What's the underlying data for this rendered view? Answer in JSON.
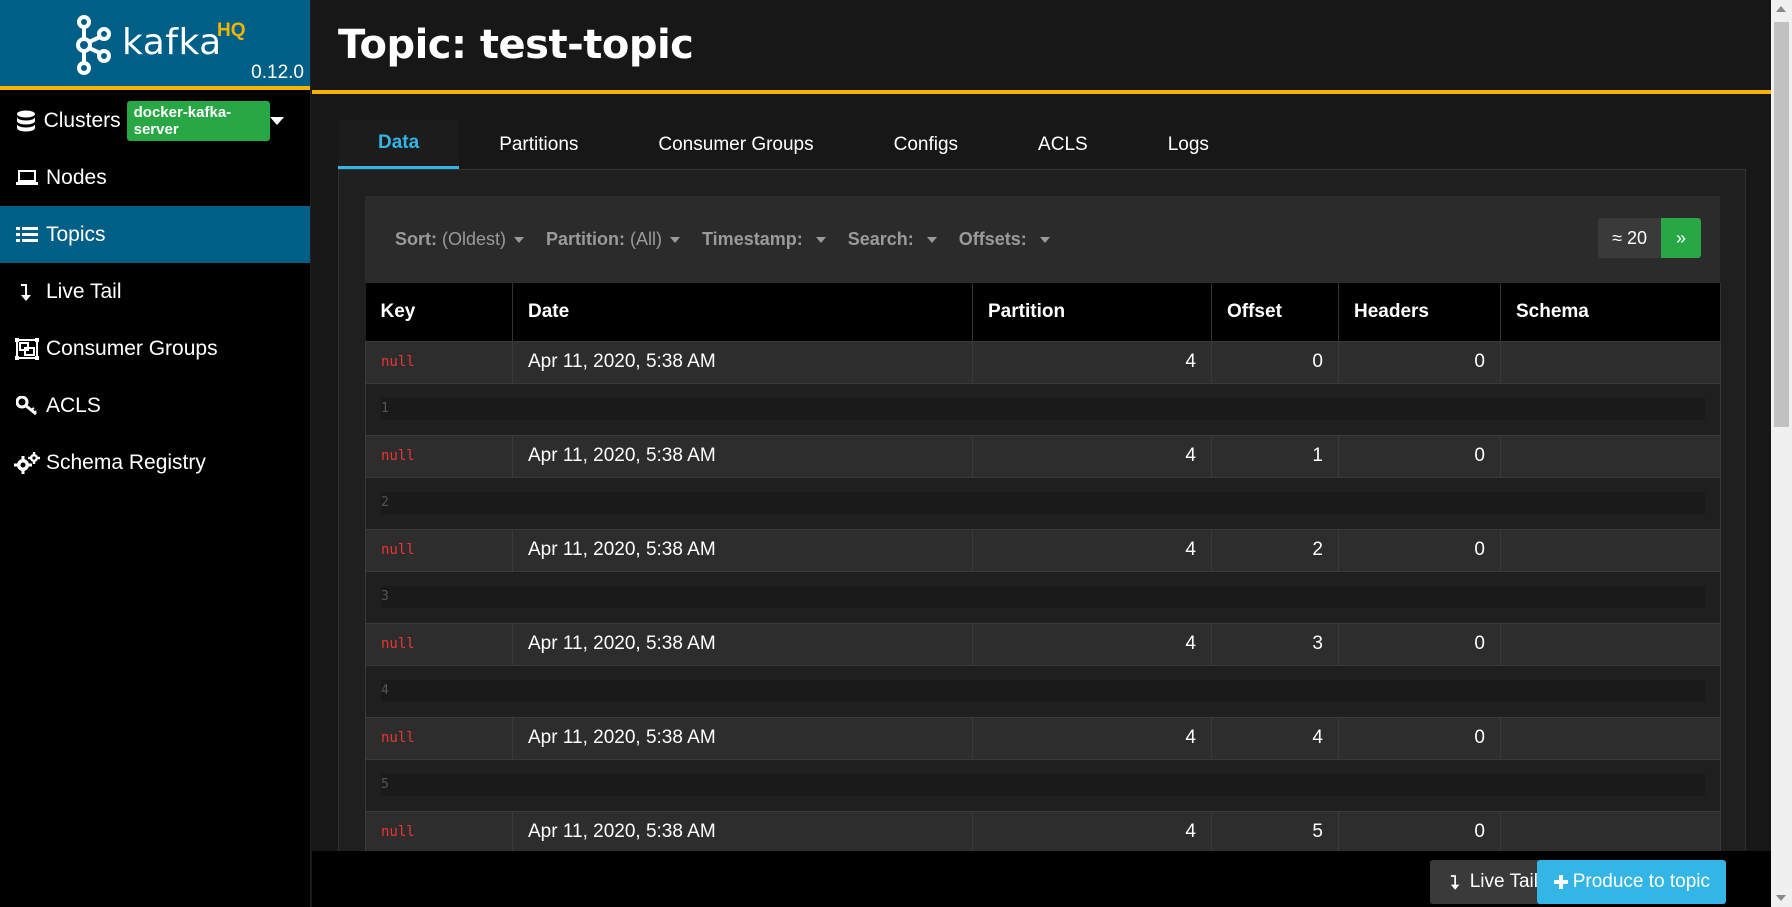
{
  "app": {
    "logo_text": "kafka",
    "logo_suffix": "HQ",
    "version": "0.12.0"
  },
  "sidebar": {
    "items": [
      {
        "label": "Clusters",
        "badge": "docker-kafka-server",
        "icon": "database-icon"
      },
      {
        "label": "Nodes",
        "icon": "laptop-icon"
      },
      {
        "label": "Topics",
        "icon": "list-icon",
        "active": true
      },
      {
        "label": "Live Tail",
        "icon": "level-down-icon"
      },
      {
        "label": "Consumer Groups",
        "icon": "object-group-icon"
      },
      {
        "label": "ACLS",
        "icon": "key-icon"
      },
      {
        "label": "Schema Registry",
        "icon": "cogs-icon"
      }
    ]
  },
  "header": {
    "title": "Topic: test-topic"
  },
  "tabs": [
    {
      "label": "Data",
      "active": true
    },
    {
      "label": "Partitions"
    },
    {
      "label": "Consumer Groups"
    },
    {
      "label": "Configs"
    },
    {
      "label": "ACLS"
    },
    {
      "label": "Logs"
    }
  ],
  "toolbar": {
    "sort_label": "Sort:",
    "sort_value": "(Oldest)",
    "partition_label": "Partition:",
    "partition_value": "(All)",
    "timestamp_label": "Timestamp:",
    "search_label": "Search:",
    "offsets_label": "Offsets:",
    "count": "≈ 20",
    "next": "»"
  },
  "table": {
    "columns": [
      "Key",
      "Date",
      "Partition",
      "Offset",
      "Headers",
      "Schema"
    ],
    "rows": [
      {
        "key": "null",
        "date": "Apr 11, 2020, 5:38 AM",
        "partition": "4",
        "offset": "0",
        "headers": "0",
        "schema": "",
        "value": "1"
      },
      {
        "key": "null",
        "date": "Apr 11, 2020, 5:38 AM",
        "partition": "4",
        "offset": "1",
        "headers": "0",
        "schema": "",
        "value": "2"
      },
      {
        "key": "null",
        "date": "Apr 11, 2020, 5:38 AM",
        "partition": "4",
        "offset": "2",
        "headers": "0",
        "schema": "",
        "value": "3"
      },
      {
        "key": "null",
        "date": "Apr 11, 2020, 5:38 AM",
        "partition": "4",
        "offset": "3",
        "headers": "0",
        "schema": "",
        "value": "4"
      },
      {
        "key": "null",
        "date": "Apr 11, 2020, 5:38 AM",
        "partition": "4",
        "offset": "4",
        "headers": "0",
        "schema": "",
        "value": "5"
      },
      {
        "key": "null",
        "date": "Apr 11, 2020, 5:38 AM",
        "partition": "4",
        "offset": "5",
        "headers": "0",
        "schema": "",
        "value": ""
      }
    ]
  },
  "footer": {
    "live_tail": "Live Tail",
    "produce": "Produce to topic"
  },
  "colors": {
    "brand": "#005f87",
    "accent": "#f5b400",
    "active_tab": "#33b5e5",
    "success": "#28a745",
    "null_key": "#ee3333"
  }
}
